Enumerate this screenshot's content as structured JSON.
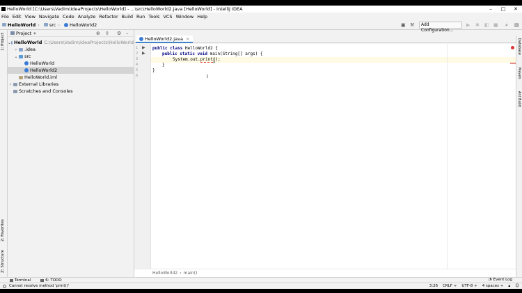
{
  "window": {
    "title": "HelloWorld [C:\\Users\\Vadim\\IdeaProjects\\HelloWorld] - ...\\src\\HelloWorld2.java [HelloWorld] - IntelliJ IDEA",
    "minimize": "–",
    "maximize": "□",
    "close": "✕"
  },
  "menu": [
    "File",
    "Edit",
    "View",
    "Navigate",
    "Code",
    "Analyze",
    "Refactor",
    "Build",
    "Run",
    "Tools",
    "VCS",
    "Window",
    "Help"
  ],
  "navbar": {
    "crumbs": [
      "HelloWorld",
      "src",
      "HelloWorld2"
    ],
    "run_config": "Add Configuration..."
  },
  "left_strip": {
    "project_tab": "1: Project",
    "favorites_tab": "2: Favorites",
    "structure_tab": "Z: Structure"
  },
  "project_panel": {
    "title": "Project",
    "tree": [
      {
        "label": "HelloWorld",
        "path": "C:\\Users\\Vadim\\IdeaProjects\\HelloWorld"
      },
      {
        "label": ".idea"
      },
      {
        "label": "src"
      },
      {
        "label": "HelloWorld"
      },
      {
        "label": "HelloWorld2"
      },
      {
        "label": "HelloWorld.iml"
      },
      {
        "label": "External Libraries"
      },
      {
        "label": "Scratches and Consoles"
      }
    ]
  },
  "editor": {
    "tab": "HelloWorld2.java",
    "line_numbers": [
      "1",
      "2",
      "3",
      "4",
      "5",
      "6"
    ],
    "code": {
      "l1_kw": "public class",
      "l1_rest": " HelloWorld2 {",
      "l2_kw": "public static void",
      "l2_rest": " main(String[] args) {",
      "l3_a": "System.out.",
      "l3_err": "print",
      "l3_b": "();",
      "l4": "}",
      "l5": "}"
    },
    "breadcrumb": [
      "HelloWorld2",
      "main()"
    ]
  },
  "right_strip": {
    "database_tab": "Database",
    "maven_tab": "Maven",
    "ant_tab": "Ant Build"
  },
  "bottom_tabs": {
    "terminal": "Terminal",
    "todo": "6: TODO",
    "event_log": "Event Log"
  },
  "status": {
    "message": "Cannot resolve method 'print()'",
    "position": "3:26",
    "line_sep": "CRLF ÷",
    "encoding": "UTF-8 ÷",
    "indent": "4 spaces ÷"
  }
}
